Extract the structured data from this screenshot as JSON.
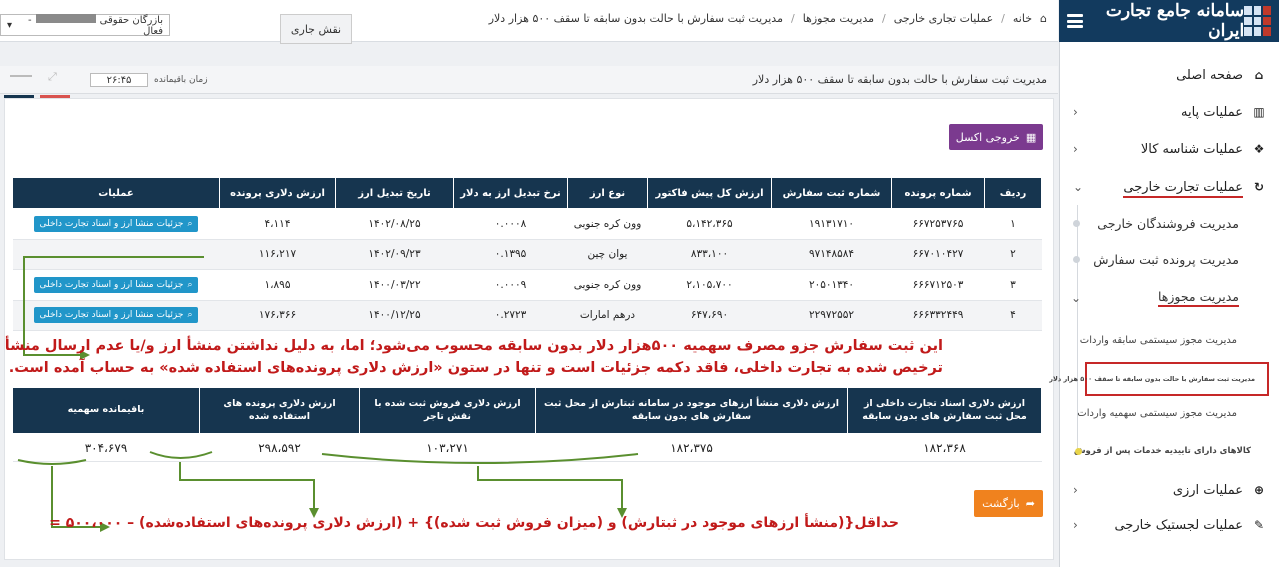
{
  "brand": {
    "title": "سامانه جامع تجارت ایران"
  },
  "topbar": {
    "role_label": "نقش جاری",
    "role_value_prefix": "بازرگان حقوقی",
    "role_value_suffix": "- فعال",
    "breadcrumb": [
      "خانه",
      "عملیات تجاری خارجی",
      "مدیریت مجوزها",
      "مدیریت ثبت سفارش با حالت بدون سابقه تا سقف ۵۰۰ هزار دلار"
    ]
  },
  "subheader": {
    "title": "مدیریت ثبت سفارش با حالت بدون سابقه تا سقف ۵۰۰ هزار دلار",
    "timer_label": "زمان باقیمانده",
    "timer_value": "۲۶:۴۵"
  },
  "sidebar": {
    "items": [
      {
        "label": "صفحه اصلی"
      },
      {
        "label": "عملیات پایه"
      },
      {
        "label": "عملیات شناسه کالا"
      },
      {
        "label": "عملیات تجارت خارجی"
      }
    ],
    "sub": [
      {
        "label": "مدیریت فروشندگان خارجی"
      },
      {
        "label": "مدیریت پرونده ثبت سفارش"
      },
      {
        "label": "مدیریت مجوزها"
      }
    ],
    "sub3": [
      {
        "label": "مدیریت مجوز سیستمی سابقه واردات"
      },
      {
        "label": "مدیریت ثبت سفارش با حالت بدون سابقه تا سقف ۵۰۰ هزار دلار"
      },
      {
        "label": "مدیریت مجوز سیستمی سهمیه واردات"
      },
      {
        "label": "کالاهای دارای تاییدیه خدمات پس از فروش"
      }
    ],
    "bottom": [
      {
        "label": "عملیات ارزی"
      },
      {
        "label": "عملیات لجستیک خارجی"
      }
    ]
  },
  "main": {
    "excel_label": "خروجی اکسل",
    "back_label": "بازگشت",
    "table1": {
      "headers": [
        "ردیف",
        "شماره پرونده",
        "شماره ثبت سفارش",
        "ارزش کل پیش فاکتور",
        "نوع ارز",
        "نرخ تبدیل ارز به دلار",
        "تاریخ تبدیل ارز",
        "ارزش دلاری پرونده",
        "عملیات"
      ],
      "rows": [
        [
          "۱",
          "۶۶۷۲۵۳۷۶۵",
          "۱۹۱۳۱۷۱۰",
          "۵،۱۴۲،۳۶۵",
          "وون کره جنوبی",
          "۰.۰۰۰۸",
          "۱۴۰۲/۰۸/۲۵",
          "۴،۱۱۴",
          true
        ],
        [
          "۲",
          "۶۶۷۰۱۰۴۲۷",
          "۹۷۱۴۸۵۸۴",
          "۸۳۳،۱۰۰",
          "یوان چین",
          "۰.۱۳۹۵",
          "۱۴۰۲/۰۹/۲۳",
          "۱۱۶،۲۱۷",
          false
        ],
        [
          "۳",
          "۶۶۶۷۱۲۵۰۳",
          "۲۰۵۰۱۳۴۰",
          "۲،۱۰۵،۷۰۰",
          "وون کره جنوبی",
          "۰.۰۰۰۹",
          "۱۴۰۰/۰۳/۲۲",
          "۱،۸۹۵",
          true
        ],
        [
          "۴",
          "۶۶۶۳۳۲۴۴۹",
          "۲۲۹۷۲۵۵۲",
          "۶۴۷،۶۹۰",
          "درهم امارات",
          "۰.۲۷۲۳",
          "۱۴۰۰/۱۲/۲۵",
          "۱۷۶،۳۶۶",
          true
        ]
      ],
      "detail_label": "جزئیات منشا ارز و اسناد تجارت داخلی"
    },
    "table2": {
      "headers": [
        "ارزش دلاری اسناد تجارت داخلی از محل ثبت سفارش های بدون سابقه",
        "ارزش دلاری منشأ ارزهای موجود در سامانه ثبتارش از محل ثبت سفارش های بدون سابقه",
        "ارزش دلاری فروش ثبت شده با نقش تاجر",
        "ارزش دلاری پرونده های استفاده شده",
        "باقیمانده سهمیه"
      ],
      "values": [
        "۱۸۲،۳۶۸",
        "۱۸۲،۳۷۵",
        "۱۰۳،۲۷۱",
        "۲۹۸،۵۹۲",
        "۳۰۴،۶۷۹"
      ]
    }
  },
  "annotation": {
    "note_line1": "این ثبت سفارش جزو مصرف سهمیه ۵۰۰هزار دلار بدون سابقه محسوب می‌شود؛ اما، به دلیل نداشتن منشأ ارز و/یا عدم ارسال منشأ ارز",
    "note_line2": "ترخیص شده به تجارت داخلی، فاقد دکمه جزئیات است و تنها در ستون «ارزش دلاری پرونده‌های استفاده شده» به حساب آمده است.",
    "formula": "حداقل{(منشأ ارزهای موجود در ثبتارش) و (میزان فروش ثبت شده)} + (ارزش دلاری پرونده‌های استفاده‌شده) – ۵۰۰،۰۰۰ =",
    "colors": {
      "red": "#c11a1a",
      "green": "#5a8f2f",
      "navy": "#16354f"
    }
  }
}
